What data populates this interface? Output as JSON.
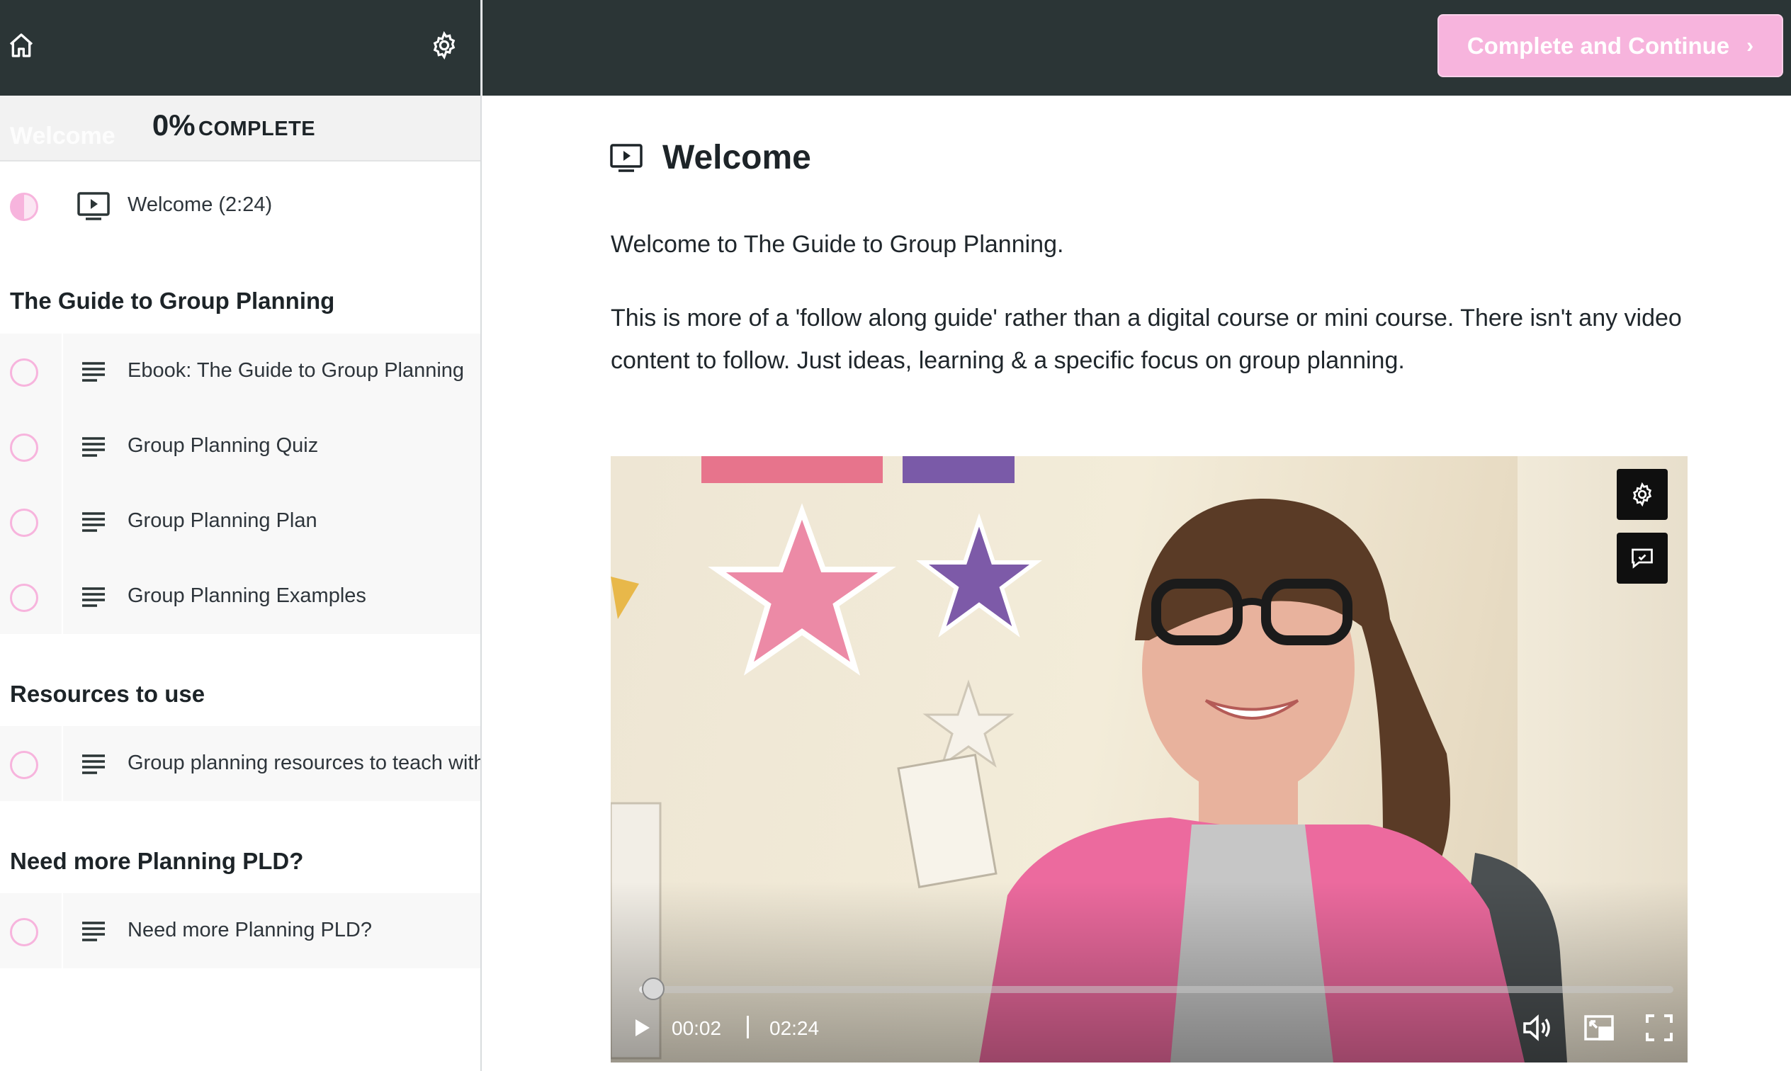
{
  "sidebar": {
    "progress": {
      "ghost": "Welcome",
      "percent": "0%",
      "label": "COMPLETE",
      "value": 0
    },
    "lessons_welcome": [
      {
        "label": "Welcome (2:24)",
        "type": "video",
        "status": "in-progress"
      }
    ],
    "chapters": [
      {
        "title": "The Guide to Group Planning",
        "lessons": [
          {
            "label": "Ebook: The Guide to Group Planning",
            "type": "text"
          },
          {
            "label": "Group Planning Quiz",
            "type": "text"
          },
          {
            "label": "Group Planning Plan",
            "type": "text"
          },
          {
            "label": "Group Planning Examples",
            "type": "text"
          }
        ]
      },
      {
        "title": "Resources to use",
        "lessons": [
          {
            "label": "Group planning resources to teach with",
            "type": "text"
          }
        ]
      },
      {
        "title": "Need more Planning PLD?",
        "lessons": [
          {
            "label": "Need more Planning PLD?",
            "type": "text"
          }
        ]
      }
    ]
  },
  "header": {
    "continue_label": "Complete and Continue",
    "continue_icon": "chevron-right-icon"
  },
  "lesson": {
    "title": "Welcome",
    "title_icon": "video-lesson-icon",
    "paragraphs": [
      "Welcome to The Guide to Group Planning.",
      "This is more of a 'follow along guide' rather than a digital course or mini course. There isn't any video content to follow. Just ideas, learning & a specific focus on group planning."
    ]
  },
  "video": {
    "current_time": "00:02",
    "duration": "02:24",
    "progress_fraction": 0.014
  },
  "colors": {
    "accent_pink": "#f7b4dd",
    "topbar": "#2b3536"
  }
}
